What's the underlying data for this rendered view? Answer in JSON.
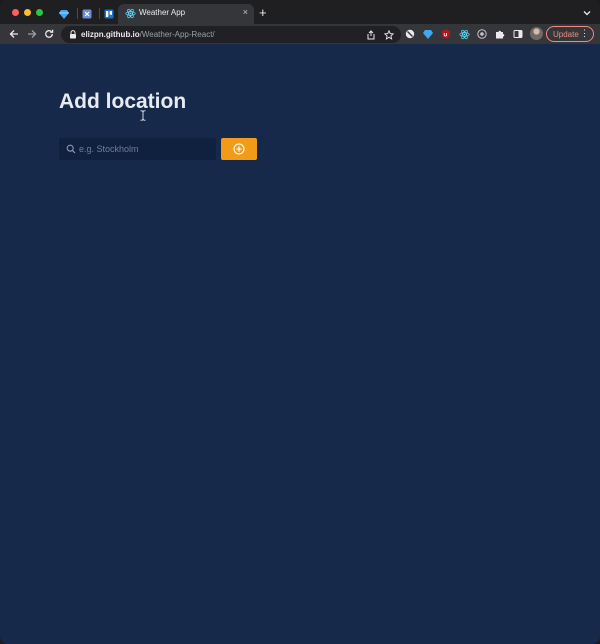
{
  "browser": {
    "tab_title": "Weather App",
    "tab_close_glyph": "×",
    "new_tab_glyph": "+",
    "url_host": "elizpn.github.io",
    "url_path": "/Weather-App-React/",
    "update_label": "Update",
    "menu_glyph": "⋮"
  },
  "page": {
    "title": "Add location",
    "search": {
      "placeholder": "e.g. Stockholm",
      "value": ""
    }
  },
  "colors": {
    "page_background": "#17294b",
    "input_background": "#10213f",
    "accent": "#f19b16",
    "title_text": "#e7ebf1",
    "update_outline": "#f28b82"
  },
  "icons": {
    "search": "search-icon",
    "add": "plus-circle-icon",
    "lock": "lock-icon"
  }
}
